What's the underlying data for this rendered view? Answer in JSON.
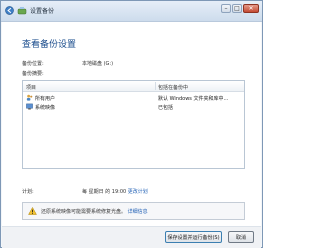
{
  "window": {
    "title": "设置备份",
    "controls": {
      "minimize": "–",
      "maximize": "□",
      "close": "✕"
    }
  },
  "main": {
    "heading": "查看备份设置",
    "backup_location_label": "备份位置:",
    "backup_location_value": "本地磁盘 (G:)",
    "backup_summary_label": "备份摘要:",
    "list": {
      "columns": [
        "项目",
        "包括在备份中"
      ],
      "rows": [
        {
          "icon": "users-icon",
          "name": "所有用户",
          "status": "默认 Windows 文件夹和库中..."
        },
        {
          "icon": "system-image-icon",
          "name": "系统映像",
          "status": "已包括"
        }
      ]
    },
    "schedule_label": "计划:",
    "schedule_value": "每 星期日 的 19:00",
    "schedule_link": "更改计划",
    "warning_text": "还原系统映像可能需要系统修复光盘。",
    "warning_link": "详细信息"
  },
  "footer": {
    "save_button": "保存设置并运行备份(S)",
    "cancel_button": "取消"
  },
  "colors": {
    "heading": "#1a4c8c",
    "link": "#1f5fb4",
    "border": "#7e98b6"
  }
}
